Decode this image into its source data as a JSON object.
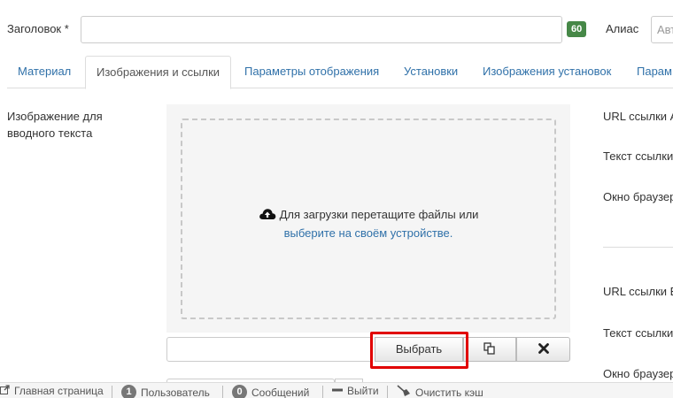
{
  "header": {
    "title_label": "Заголовок *",
    "char_count": "60",
    "alias_label": "Алиас",
    "alias_placeholder": "Авт"
  },
  "tabs": [
    {
      "label": "Материал"
    },
    {
      "label": "Изображения и ссылки"
    },
    {
      "label": "Параметры отображения"
    },
    {
      "label": "Установки"
    },
    {
      "label": "Изображения установок"
    },
    {
      "label": "Парам"
    }
  ],
  "intro_image": {
    "label": "Изображение для вводного текста",
    "drop_text": "Для загрузки перетащите файлы или",
    "drop_link": "выберите на своём устройстве.",
    "select_button": "Выбрать"
  },
  "links": {
    "a_url_label": "URL ссылки А",
    "a_text_label": "Текст ссылки",
    "a_window_label": "Окно браузер",
    "b_url_label": "URL ссылки Б",
    "b_text_label": "Текст ссылки",
    "b_window_label": "Окно браузер"
  },
  "statusbar": {
    "home": "Главная страница",
    "users_count": "1",
    "users_label": "Пользователь",
    "messages_count": "0",
    "messages_label": "Сообщений",
    "logout": "Выйти",
    "clear_cache": "Очистить кэш"
  },
  "colors": {
    "link": "#3071a9",
    "highlight": "#e10000",
    "count_badge": "#468847"
  }
}
